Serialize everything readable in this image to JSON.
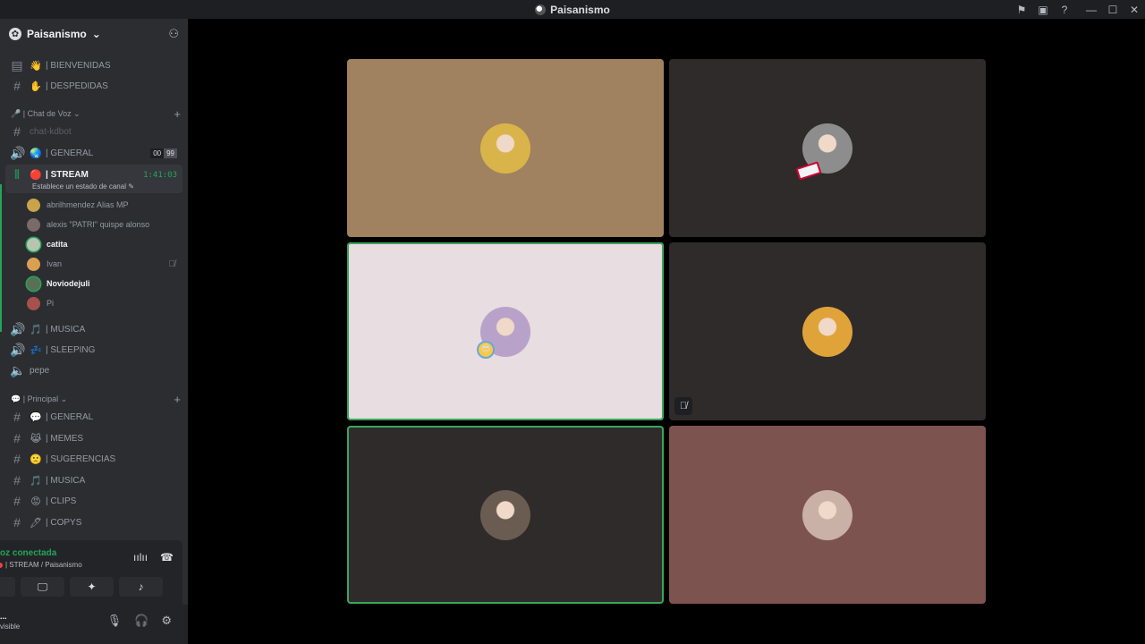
{
  "window": {
    "title": "Paisanismo"
  },
  "server": {
    "name": "Paisanismo"
  },
  "channels_top": [
    {
      "emoji": "👋",
      "label": "| BIENVENIDAS"
    },
    {
      "emoji": "✋",
      "label": "| DESPEDIDAS"
    }
  ],
  "voice_category": {
    "label": "| Chat de Voz"
  },
  "voice_channels": {
    "chat_kdbot": "chat-kdbot",
    "general": {
      "label": "| GENERAL",
      "count": "00",
      "limit": "99"
    },
    "stream": {
      "label": "| STREAM",
      "time": "1:41:03",
      "status": "Establece un estado de canal"
    },
    "musica": "| MUSICA",
    "sleeping": "| SLEEPING",
    "pepe": "pepe"
  },
  "stream_members": [
    {
      "name": "abrilhmendez Alias MP",
      "bold": false
    },
    {
      "name": "alexis \"PATRI\" quispe alonso",
      "bold": false
    },
    {
      "name": "catita",
      "bold": true
    },
    {
      "name": "Ivan",
      "bold": false
    },
    {
      "name": "Noviodejuli",
      "bold": true
    },
    {
      "name": "Pi",
      "bold": false
    }
  ],
  "principal_category": {
    "label": "| Principal"
  },
  "principal_channels": [
    {
      "emoji": "💬",
      "label": "| GENERAL"
    },
    {
      "emoji": "😹",
      "label": "| MEMES"
    },
    {
      "emoji": "🙁",
      "label": "| SUGERENCIAS"
    },
    {
      "emoji": "🎵",
      "label": "| MUSICA"
    },
    {
      "emoji": "😡",
      "label": "| CLIPS"
    },
    {
      "emoji": "🖊",
      "label": "| COPYS"
    }
  ],
  "voice_panel": {
    "status": "oz conectada",
    "location": "| STREAM / Paisanismo"
  },
  "user_panel": {
    "name": "...",
    "status": "visible"
  },
  "tiles": [
    {
      "bg": "#a08260",
      "avatar_bg": "#d9b44a",
      "speaking": false
    },
    {
      "bg": "#2f2b2b",
      "avatar_bg": "#8d8d8d",
      "speaking": false
    },
    {
      "bg": "#e8dde0",
      "avatar_bg": "#b9a2c9",
      "speaking": true
    },
    {
      "bg": "#2f2b2b",
      "avatar_bg": "#e0a33a",
      "speaking": false
    },
    {
      "bg": "#2f2b2b",
      "avatar_bg": "#6b5c52",
      "speaking": true
    },
    {
      "bg": "#7d5350",
      "avatar_bg": "#c9b1a8",
      "speaking": false
    }
  ]
}
